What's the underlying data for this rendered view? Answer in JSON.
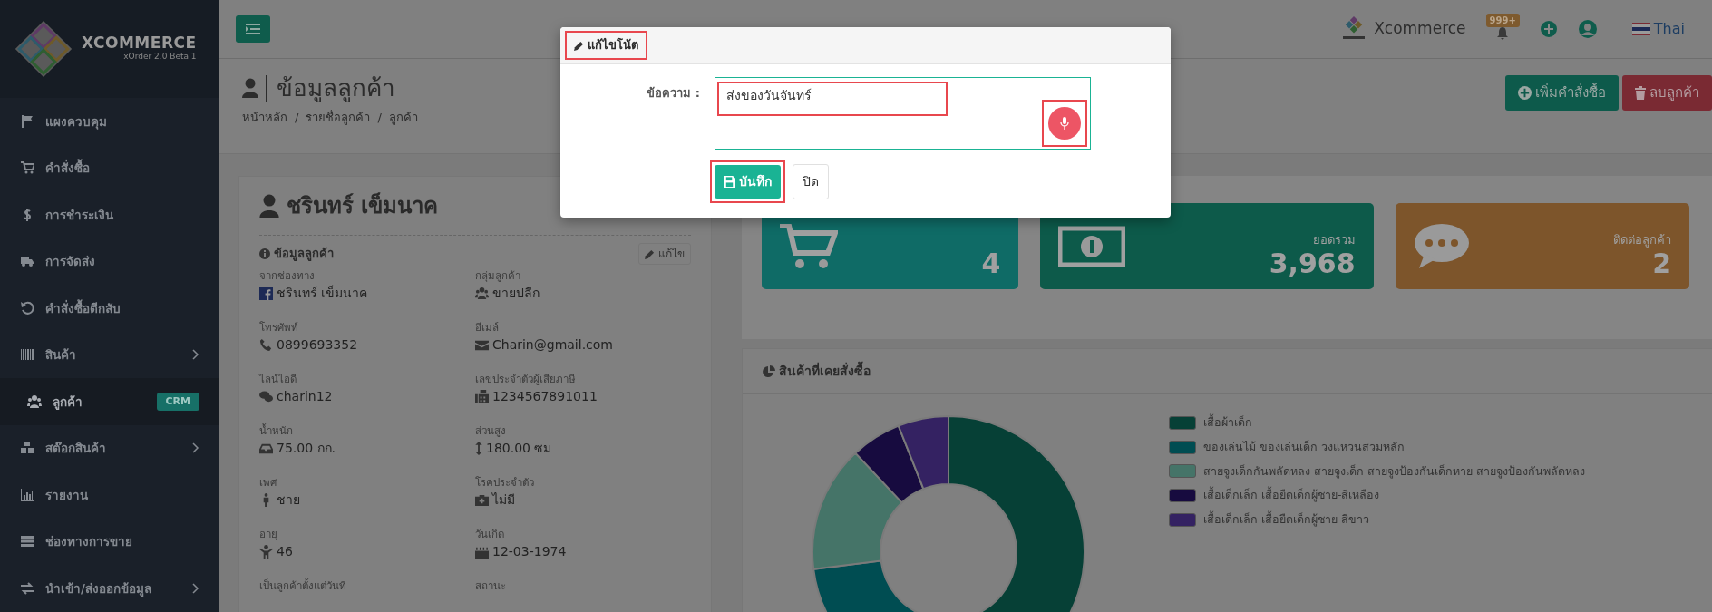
{
  "sidebar": {
    "brand": "XCOMMERCE",
    "version": "xOrder 2.0 Beta 1",
    "items": [
      {
        "label": "แผงควบคุม",
        "selected": false,
        "submenu": false
      },
      {
        "label": "คำสั่งซื้อ",
        "selected": false,
        "submenu": false
      },
      {
        "label": "การชำระเงิน",
        "selected": false,
        "submenu": false
      },
      {
        "label": "การจัดส่ง",
        "selected": false,
        "submenu": false
      },
      {
        "label": "คำสั่งซื้อตีกลับ",
        "selected": false,
        "submenu": false
      },
      {
        "label": "สินค้า",
        "selected": false,
        "submenu": true
      },
      {
        "label": "ลูกค้า",
        "selected": true,
        "submenu": false,
        "badge": "CRM"
      },
      {
        "label": "สต๊อกสินค้า",
        "selected": false,
        "submenu": true
      },
      {
        "label": "รายงาน",
        "selected": false,
        "submenu": false
      },
      {
        "label": "ช่องทางการขาย",
        "selected": false,
        "submenu": false
      },
      {
        "label": "นำเข้า/ส่งออกข้อมูล",
        "selected": false,
        "submenu": true
      }
    ]
  },
  "topbar": {
    "shop_name": "Xcommerce",
    "notification_count": "999+",
    "language": "Thai"
  },
  "page": {
    "title": "ข้อมูลลูกค้า",
    "breadcrumbs": [
      "หน้าหลัก",
      "รายชื่อลูกค้า",
      "ลูกค้า"
    ],
    "breadcrumb_separator": "/",
    "actions": [
      {
        "label": "เพิ่มคำสั่งซื้อ",
        "kind": "add"
      },
      {
        "label": "ลบลูกค้า",
        "kind": "delete"
      }
    ]
  },
  "customer": {
    "name": "ชรินทร์ เข็มนาค",
    "section_title": "ข้อมูลลูกค้า",
    "edit_label": "แก้ไข",
    "fields": [
      {
        "label": "จากช่องทาง",
        "value": "ชรินทร์ เข็มนาค"
      },
      {
        "label": "กลุ่มลูกค้า",
        "value": "ขายปลีก"
      },
      {
        "label": "โทรศัพท์",
        "value": "0899693352"
      },
      {
        "label": "อีเมล์",
        "value": "Charin@gmail.com"
      },
      {
        "label": "ไลน์ไอดี",
        "value": "charin12"
      },
      {
        "label": "เลขประจำตัวผู้เสียภาษี",
        "value": "1234567891011"
      },
      {
        "label": "น้ำหนัก",
        "value": "75.00 กก."
      },
      {
        "label": "ส่วนสูง",
        "value": "180.00 ซม"
      },
      {
        "label": "เพศ",
        "value": "ชาย"
      },
      {
        "label": "โรคประจำตัว",
        "value": "ไม่มี"
      },
      {
        "label": "อายุ",
        "value": "46"
      },
      {
        "label": "วันเกิด",
        "value": "12-03-1974"
      },
      {
        "label": "เป็นลูกค้าตั้งแต่วันที่"
      },
      {
        "label": "สถานะ"
      }
    ]
  },
  "stats": [
    {
      "kind": "orders",
      "value": "4"
    },
    {
      "kind": "total",
      "label": "ยอดรวม",
      "value": "3,968"
    },
    {
      "kind": "contact",
      "label": "ติดต่อลูกค้า",
      "value": "2"
    }
  ],
  "chart_card": {
    "title": "สินค้าที่เคยสั่งซื้อ",
    "legend": [
      {
        "label": "เสื้อผ้าเด็ก",
        "color": "#064036"
      },
      {
        "label": "ของเล่นไม้ ของเล่นเด็ก วงแหวนสวมหลัก",
        "color": "#004d52"
      },
      {
        "label": "สายจูงเด็กกันพลัดหลง สายจูงเด็ก สายจูงป้องกันเด็กหาย สายจูงป้องกันพลัดหลง",
        "color": "#457468"
      },
      {
        "label": "เสื้อเด็กเล็ก เสื้อยืดเด็กผู้ชาย-สีเหลือง",
        "color": "#170b3f"
      },
      {
        "label": "เสื้อเด็กเล็ก เสื้อยืดเด็กผู้ชาย-สีขาว",
        "color": "#342262"
      }
    ]
  },
  "modal": {
    "title": "แก้ไขโน้ต",
    "title_highlighted": true,
    "field_label": "ข้อความ :",
    "value": "ส่งของวันจันทร์",
    "value_highlighted": true,
    "mic_highlighted": true,
    "save_label": "บันทึก",
    "save_highlighted": true,
    "close_label": "ปิด"
  }
}
